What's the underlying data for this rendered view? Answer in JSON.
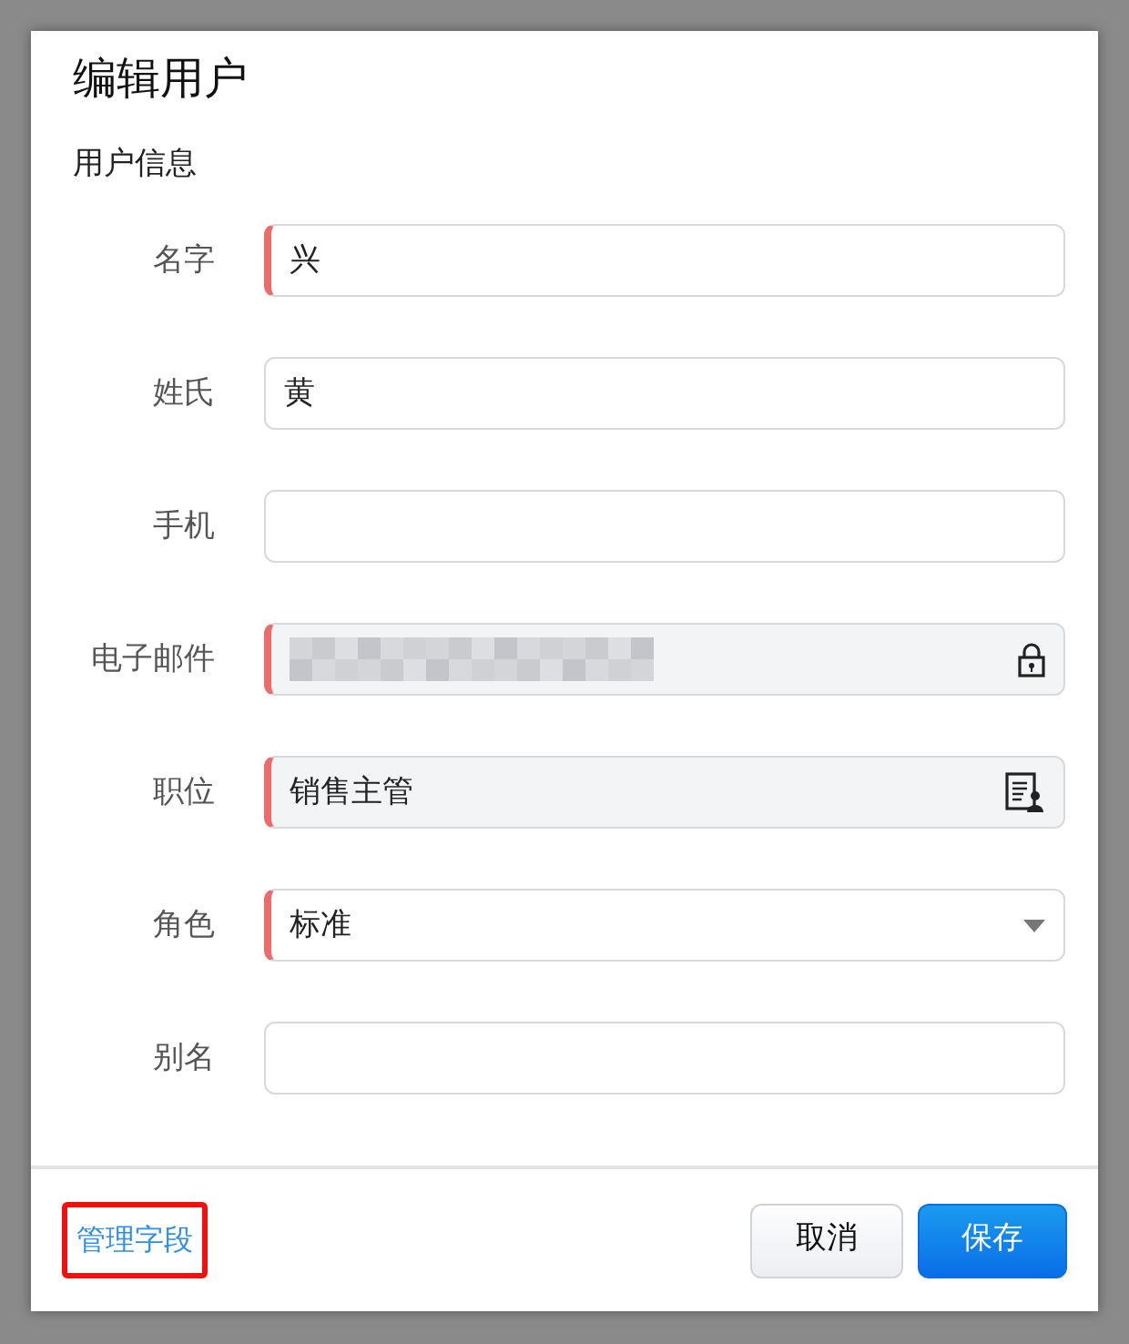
{
  "dialog": {
    "title": "编辑用户"
  },
  "section": {
    "title": "用户信息"
  },
  "fields": [
    {
      "label": "名字",
      "kind": "text",
      "value": "兴",
      "required": true,
      "readonly": false
    },
    {
      "label": "姓氏",
      "kind": "text",
      "value": "黄",
      "required": false,
      "readonly": false
    },
    {
      "label": "手机",
      "kind": "text",
      "required": false,
      "readonly": false
    },
    {
      "label": "电子邮件",
      "kind": "locked",
      "redacted": true,
      "required": true,
      "readonly": true
    },
    {
      "label": "职位",
      "kind": "lookup",
      "value": "销售主管",
      "required": true,
      "readonly": true
    },
    {
      "label": "角色",
      "kind": "select",
      "value": "标准",
      "required": true,
      "readonly": false
    },
    {
      "label": "别名",
      "kind": "text",
      "required": false,
      "readonly": false
    }
  ],
  "footer": {
    "link": {
      "label": "管理字段",
      "highlighted": true
    },
    "buttons": [
      {
        "label": "取消",
        "kind": "secondary"
      },
      {
        "label": "保存",
        "kind": "primary"
      }
    ]
  }
}
